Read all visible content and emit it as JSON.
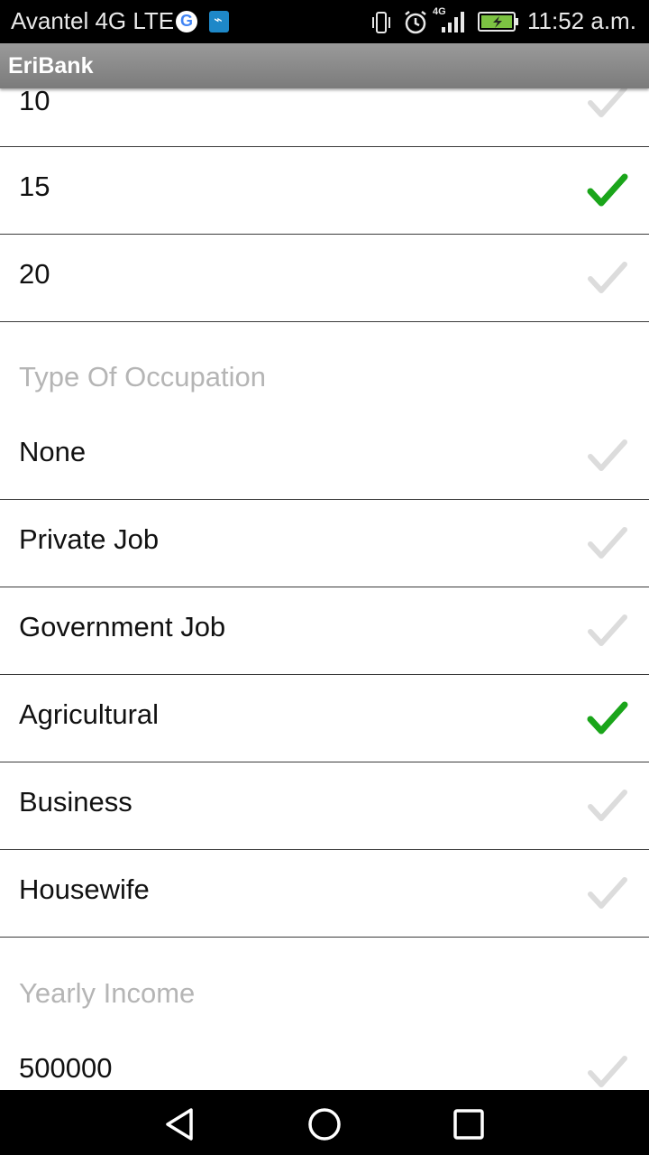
{
  "status_bar": {
    "carrier": "Avantel 4G LTE",
    "network_badge": "4G",
    "time": "11:52 a.m.",
    "icons": [
      "google-icon",
      "usb-icon",
      "vibrate-icon",
      "alarm-icon",
      "signal-icon",
      "battery-icon"
    ]
  },
  "app_bar": {
    "title": "EriBank"
  },
  "list": {
    "rows_top": [
      {
        "label": "10",
        "checked": false
      },
      {
        "label": "15",
        "checked": true
      },
      {
        "label": "20",
        "checked": false
      }
    ],
    "occupation_header": "Type Of Occupation",
    "occupations": [
      {
        "label": "None",
        "checked": false
      },
      {
        "label": "Private Job",
        "checked": false
      },
      {
        "label": "Government Job",
        "checked": false
      },
      {
        "label": "Agricultural",
        "checked": true
      },
      {
        "label": "Business",
        "checked": false
      },
      {
        "label": "Housewife",
        "checked": false
      }
    ],
    "income_header": "Yearly Income",
    "incomes": [
      {
        "label": "500000",
        "checked": false
      }
    ]
  },
  "colors": {
    "check_active": "#1aa51a",
    "check_inactive": "#dcdcdc",
    "header_text": "#b5b5b5"
  },
  "nav_bar": {
    "icons": [
      "back-icon",
      "home-icon",
      "recents-icon"
    ]
  }
}
